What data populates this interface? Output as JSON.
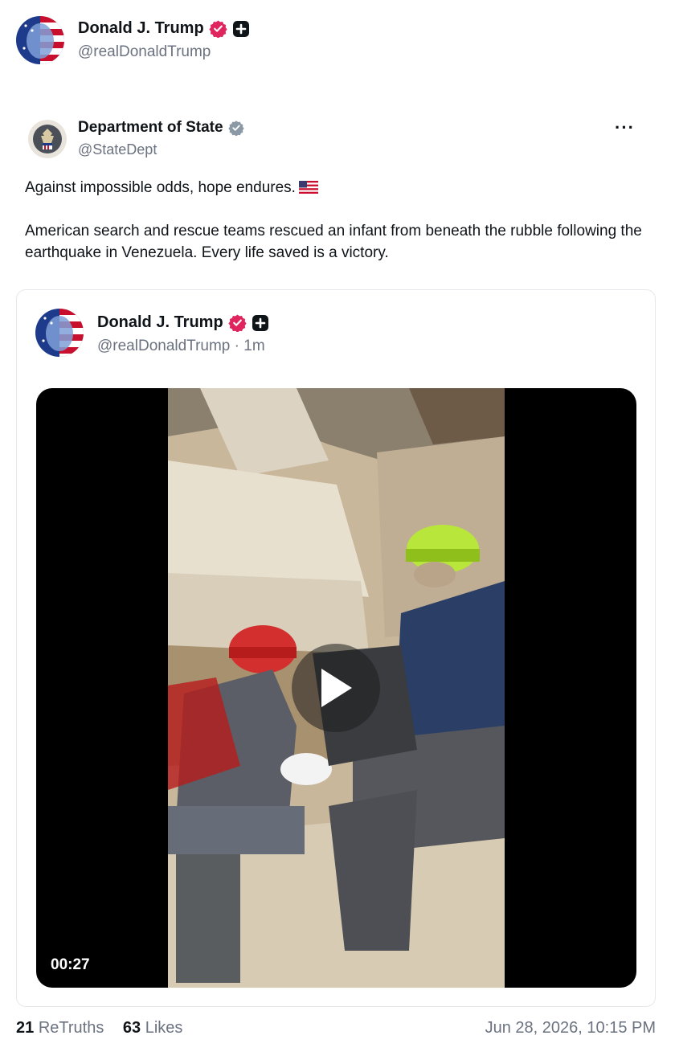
{
  "header": {
    "display_name": "Donald J. Trump",
    "handle": "@realDonaldTrump",
    "avatar_icon": "flag-face-avatar",
    "verified_icon": "verified-badge-icon",
    "plus_icon": "plus-badge-icon"
  },
  "retruth": {
    "display_name": "Department of State",
    "handle": "@StateDept",
    "avatar_icon": "state-dept-seal",
    "more_label": "···",
    "text_line1": "Against impossible odds, hope endures.",
    "text_line2": "American search and rescue teams rescued an infant from beneath the rubble following the earthquake in Venezuela. Every life saved is a victory."
  },
  "quoted": {
    "display_name": "Donald J. Trump",
    "handle_time": "@realDonaldTrump · 1m",
    "video_duration": "00:27",
    "play_icon": "play-icon"
  },
  "stats": {
    "retruths_count": "21",
    "retruths_label": "ReTruths",
    "likes_count": "63",
    "likes_label": "Likes",
    "timestamp": "Jun 28, 2026, 10:15 PM"
  },
  "colors": {
    "verified": "#e0245e",
    "state_verified": "#8b98a5",
    "muted": "#6b7280"
  }
}
